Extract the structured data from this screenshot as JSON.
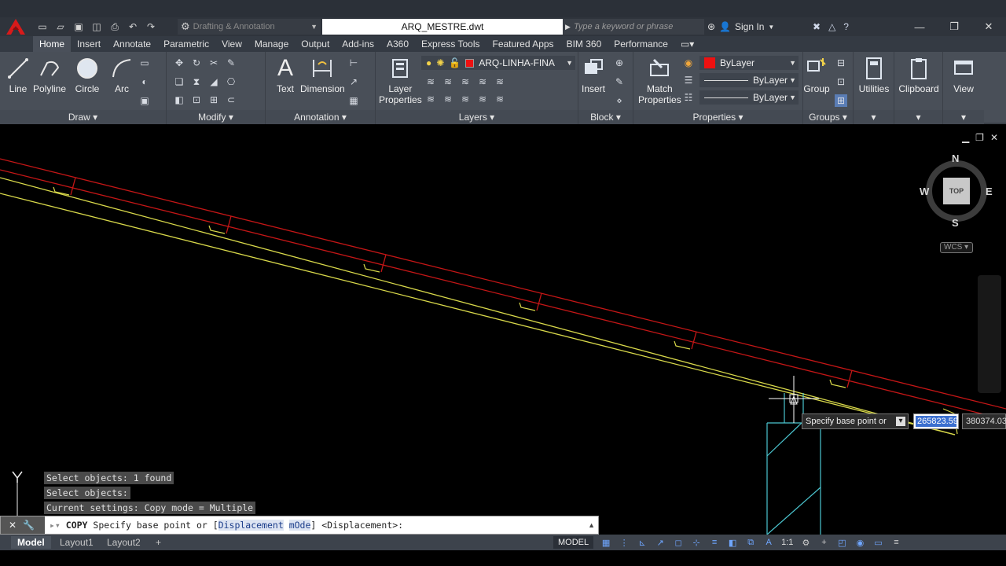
{
  "title_bar": {
    "workspace": "Drafting & Annotation",
    "document_title": "ARQ_MESTRE.dwt",
    "search_placeholder": "Type a keyword or phrase",
    "sign_in": "Sign In"
  },
  "ribbon_tabs": [
    "Home",
    "Insert",
    "Annotate",
    "Parametric",
    "View",
    "Manage",
    "Output",
    "Add-ins",
    "A360",
    "Express Tools",
    "Featured Apps",
    "BIM 360",
    "Performance"
  ],
  "ribbon": {
    "draw": {
      "title": "Draw",
      "line": "Line",
      "polyline": "Polyline",
      "circle": "Circle",
      "arc": "Arc"
    },
    "modify": {
      "title": "Modify"
    },
    "annotation": {
      "title": "Annotation",
      "text": "Text",
      "dimension": "Dimension"
    },
    "layers": {
      "title": "Layers",
      "layer_properties_1": "Layer",
      "layer_properties_2": "Properties",
      "current_layer": "ARQ-LINHA-FINA",
      "current_layer_color": "#e01010"
    },
    "block": {
      "title": "Block",
      "insert": "Insert"
    },
    "properties": {
      "title": "Properties",
      "match_1": "Match",
      "match_2": "Properties",
      "color": "ByLayer",
      "linetype": "ByLayer",
      "lineweight": "ByLayer"
    },
    "groups": {
      "title": "Groups",
      "group": "Group"
    },
    "utilities": "Utilities",
    "clipboard": "Clipboard",
    "view": "View"
  },
  "viewcube": {
    "north": "N",
    "south": "S",
    "east": "E",
    "west": "W",
    "face": "TOP",
    "wcs": "WCS"
  },
  "dynamic_input": {
    "label": "Specify base point or",
    "x_value": "265823.59",
    "y_value": "380374.03"
  },
  "command_history": [
    "Select objects: 1 found",
    "Select objects:",
    "Current settings:  Copy mode = Multiple"
  ],
  "command_line": {
    "command": "COPY",
    "prompt": "Specify base point or [",
    "option1": "Displacement",
    "option2": "mOde",
    "suffix": "] <Displacement>:"
  },
  "status_bar": {
    "tabs": [
      "Model",
      "Layout1",
      "Layout2"
    ],
    "model_label": "MODEL",
    "scale": "1:1"
  },
  "colors": {
    "red_line": "#c41616",
    "yellow_line": "#d8d84a",
    "cyan_line": "#4bc6d0",
    "accent": "#3b6fcf"
  }
}
